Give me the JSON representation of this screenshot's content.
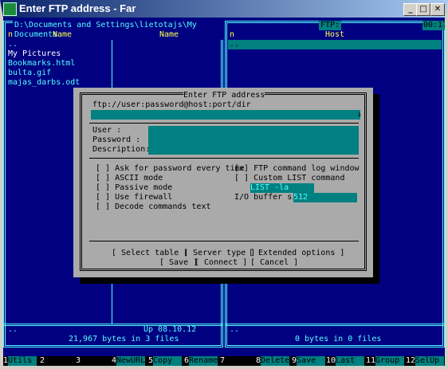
{
  "window": {
    "title": "Enter FTP address - Far",
    "min": "_",
    "max": "□",
    "close": "✕"
  },
  "left_panel": {
    "path": " D:\\Documents and Settings\\lietotajs\\My Documents ",
    "col_n1": "n",
    "col_name1": "Name",
    "col_name2": "Name",
    "files": [
      "..",
      "My Pictures",
      "Bookmarks.html",
      "bulta.gif",
      "majas_darbs.odt"
    ],
    "status_left": "..",
    "status_right": "Up  08.10.12 23:53",
    "summary": " 21,967 bytes in 3 files "
  },
  "right_panel": {
    "path": " FTP: ",
    "clock": "00:17",
    "col_n": "n",
    "col_host": "Host",
    "files": [
      ".."
    ],
    "status_left": "..",
    "summary": " 0 bytes in 0 files "
  },
  "dialog": {
    "title": " Enter FTP address ",
    "hint": "ftp://user:password@host:port/dir",
    "user_label": "User        :",
    "password_label": "Password    :",
    "description_label": "Description:",
    "opt_ask_password": "[ ] Ask for password every time",
    "opt_ascii": "[ ] ASCII mode",
    "opt_passive": "[ ] Passive mode",
    "opt_firewall": "[ ] Use firewall",
    "opt_decode": "[ ] Decode commands text",
    "opt_ftp_log": "[x] FTP command log window",
    "opt_custom_list": "[ ] Custom LIST command",
    "custom_list_value": "LIST -la",
    "buffer_label": "I/O buffer size:",
    "buffer_value": "512",
    "btn_select_table": "[ Select table ]",
    "btn_server_type": "[ Server type ]",
    "btn_extended": "[ Extended options ]",
    "btn_save": "[ Save ]",
    "btn_connect": "[ Connect ]",
    "btn_cancel": "[ Cancel ]"
  },
  "keybar": [
    {
      "n": "1",
      "l": "Utils"
    },
    {
      "n": "2",
      "l": ""
    },
    {
      "n": "3",
      "l": ""
    },
    {
      "n": "4",
      "l": "NewURL"
    },
    {
      "n": "5",
      "l": "Copy"
    },
    {
      "n": "6",
      "l": "Rename"
    },
    {
      "n": "7",
      "l": ""
    },
    {
      "n": "8",
      "l": "Delete"
    },
    {
      "n": "9",
      "l": "Save"
    },
    {
      "n": "10",
      "l": "Last"
    },
    {
      "n": "11",
      "l": "Group"
    },
    {
      "n": "12",
      "l": "SelUp"
    }
  ]
}
